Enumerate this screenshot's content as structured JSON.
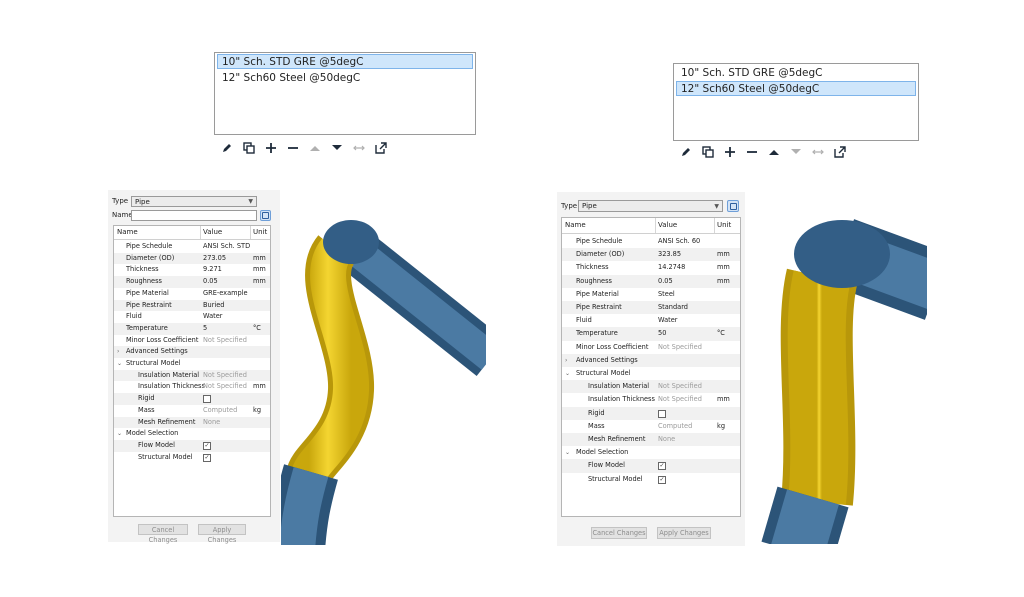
{
  "left": {
    "schedule_list": {
      "items": [
        "10\" Sch. STD GRE @5degC",
        "12\" Sch60 Steel @50degC"
      ],
      "selected_index": 0
    },
    "panel": {
      "type_label": "Type",
      "type_value": "Pipe",
      "name_label": "Name",
      "name_value": "",
      "headers": {
        "name": "Name",
        "value": "Value",
        "unit": "Unit"
      },
      "rows": [
        {
          "name": "Pipe Schedule",
          "value": "ANSI Sch. STD",
          "unit": "",
          "indent": 1
        },
        {
          "name": "Diameter (OD)",
          "value": "273.05",
          "unit": "mm",
          "indent": 1
        },
        {
          "name": "Thickness",
          "value": "9.271",
          "unit": "mm",
          "indent": 1
        },
        {
          "name": "Roughness",
          "value": "0.05",
          "unit": "mm",
          "indent": 1
        },
        {
          "name": "Pipe Material",
          "value": "GRE-example",
          "unit": "",
          "indent": 1
        },
        {
          "name": "Pipe Restraint",
          "value": "Buried",
          "unit": "",
          "indent": 1
        },
        {
          "name": "Fluid",
          "value": "Water",
          "unit": "",
          "indent": 1
        },
        {
          "name": "Temperature",
          "value": "5",
          "unit": "°C",
          "indent": 1
        },
        {
          "name": "Minor Loss Coefficient",
          "value": "Not Specified",
          "unit": "",
          "indent": 1,
          "muted": true
        },
        {
          "name": "Advanced Settings",
          "value": "",
          "unit": "",
          "indent": 0,
          "group": "collapsed"
        },
        {
          "name": "Structural Model",
          "value": "",
          "unit": "",
          "indent": 0,
          "group": "expanded"
        },
        {
          "name": "Insulation Material",
          "value": "Not Specified",
          "unit": "",
          "indent": 2,
          "muted": true
        },
        {
          "name": "Insulation Thickness",
          "value": "Not Specified",
          "unit": "mm",
          "indent": 2,
          "muted": true
        },
        {
          "name": "Rigid",
          "value": "",
          "unit": "",
          "indent": 2,
          "checkbox": false
        },
        {
          "name": "Mass",
          "value": "Computed",
          "unit": "kg",
          "indent": 2,
          "muted": true
        },
        {
          "name": "Mesh Refinement",
          "value": "None",
          "unit": "",
          "indent": 2,
          "muted": true
        },
        {
          "name": "Model Selection",
          "value": "",
          "unit": "",
          "indent": 0,
          "group": "expanded"
        },
        {
          "name": "Flow Model",
          "value": "",
          "unit": "",
          "indent": 2,
          "checkbox": true
        },
        {
          "name": "Structural Model",
          "value": "",
          "unit": "",
          "indent": 2,
          "checkbox": true
        }
      ],
      "cancel_label": "Cancel Changes",
      "apply_label": "Apply Changes"
    }
  },
  "right": {
    "schedule_list": {
      "items": [
        "10\" Sch. STD GRE @5degC",
        "12\" Sch60 Steel @50degC"
      ],
      "selected_index": 1
    },
    "panel": {
      "type_label": "Type",
      "type_value": "Pipe",
      "headers": {
        "name": "Name",
        "value": "Value",
        "unit": "Unit"
      },
      "rows": [
        {
          "name": "Pipe Schedule",
          "value": "ANSI Sch. 60",
          "unit": "",
          "indent": 1
        },
        {
          "name": "Diameter (OD)",
          "value": "323.85",
          "unit": "mm",
          "indent": 1
        },
        {
          "name": "Thickness",
          "value": "14.2748",
          "unit": "mm",
          "indent": 1
        },
        {
          "name": "Roughness",
          "value": "0.05",
          "unit": "mm",
          "indent": 1
        },
        {
          "name": "Pipe Material",
          "value": "Steel",
          "unit": "",
          "indent": 1
        },
        {
          "name": "Pipe Restraint",
          "value": "Standard",
          "unit": "",
          "indent": 1
        },
        {
          "name": "Fluid",
          "value": "Water",
          "unit": "",
          "indent": 1
        },
        {
          "name": "Temperature",
          "value": "50",
          "unit": "°C",
          "indent": 1
        },
        {
          "name": "Minor Loss Coefficient",
          "value": "Not Specified",
          "unit": "",
          "indent": 1,
          "muted": true
        },
        {
          "name": "Advanced Settings",
          "value": "",
          "unit": "",
          "indent": 0,
          "group": "collapsed"
        },
        {
          "name": "Structural Model",
          "value": "",
          "unit": "",
          "indent": 0,
          "group": "expanded"
        },
        {
          "name": "Insulation Material",
          "value": "Not Specified",
          "unit": "",
          "indent": 2,
          "muted": true
        },
        {
          "name": "Insulation Thickness",
          "value": "Not Specified",
          "unit": "mm",
          "indent": 2,
          "muted": true
        },
        {
          "name": "Rigid",
          "value": "",
          "unit": "",
          "indent": 2,
          "checkbox": false
        },
        {
          "name": "Mass",
          "value": "Computed",
          "unit": "kg",
          "indent": 2,
          "muted": true
        },
        {
          "name": "Mesh Refinement",
          "value": "None",
          "unit": "",
          "indent": 2,
          "muted": true
        },
        {
          "name": "Model Selection",
          "value": "",
          "unit": "",
          "indent": 0,
          "group": "expanded"
        },
        {
          "name": "Flow Model",
          "value": "",
          "unit": "",
          "indent": 2,
          "checkbox": true
        },
        {
          "name": "Structural Model",
          "value": "",
          "unit": "",
          "indent": 2,
          "checkbox": true
        }
      ],
      "cancel_label": "Cancel Changes",
      "apply_label": "Apply Changes"
    }
  },
  "toolbar_icons": [
    "edit-icon",
    "duplicate-icon",
    "add-icon",
    "remove-icon",
    "move-up-icon",
    "move-down-icon",
    "swap-icon",
    "export-icon"
  ],
  "colors": {
    "pipe_blue": "#3f6c93",
    "pipe_yellow": "#e8c51a",
    "selection": "#cfe6fb",
    "icon_button": "#d4e4f6"
  }
}
